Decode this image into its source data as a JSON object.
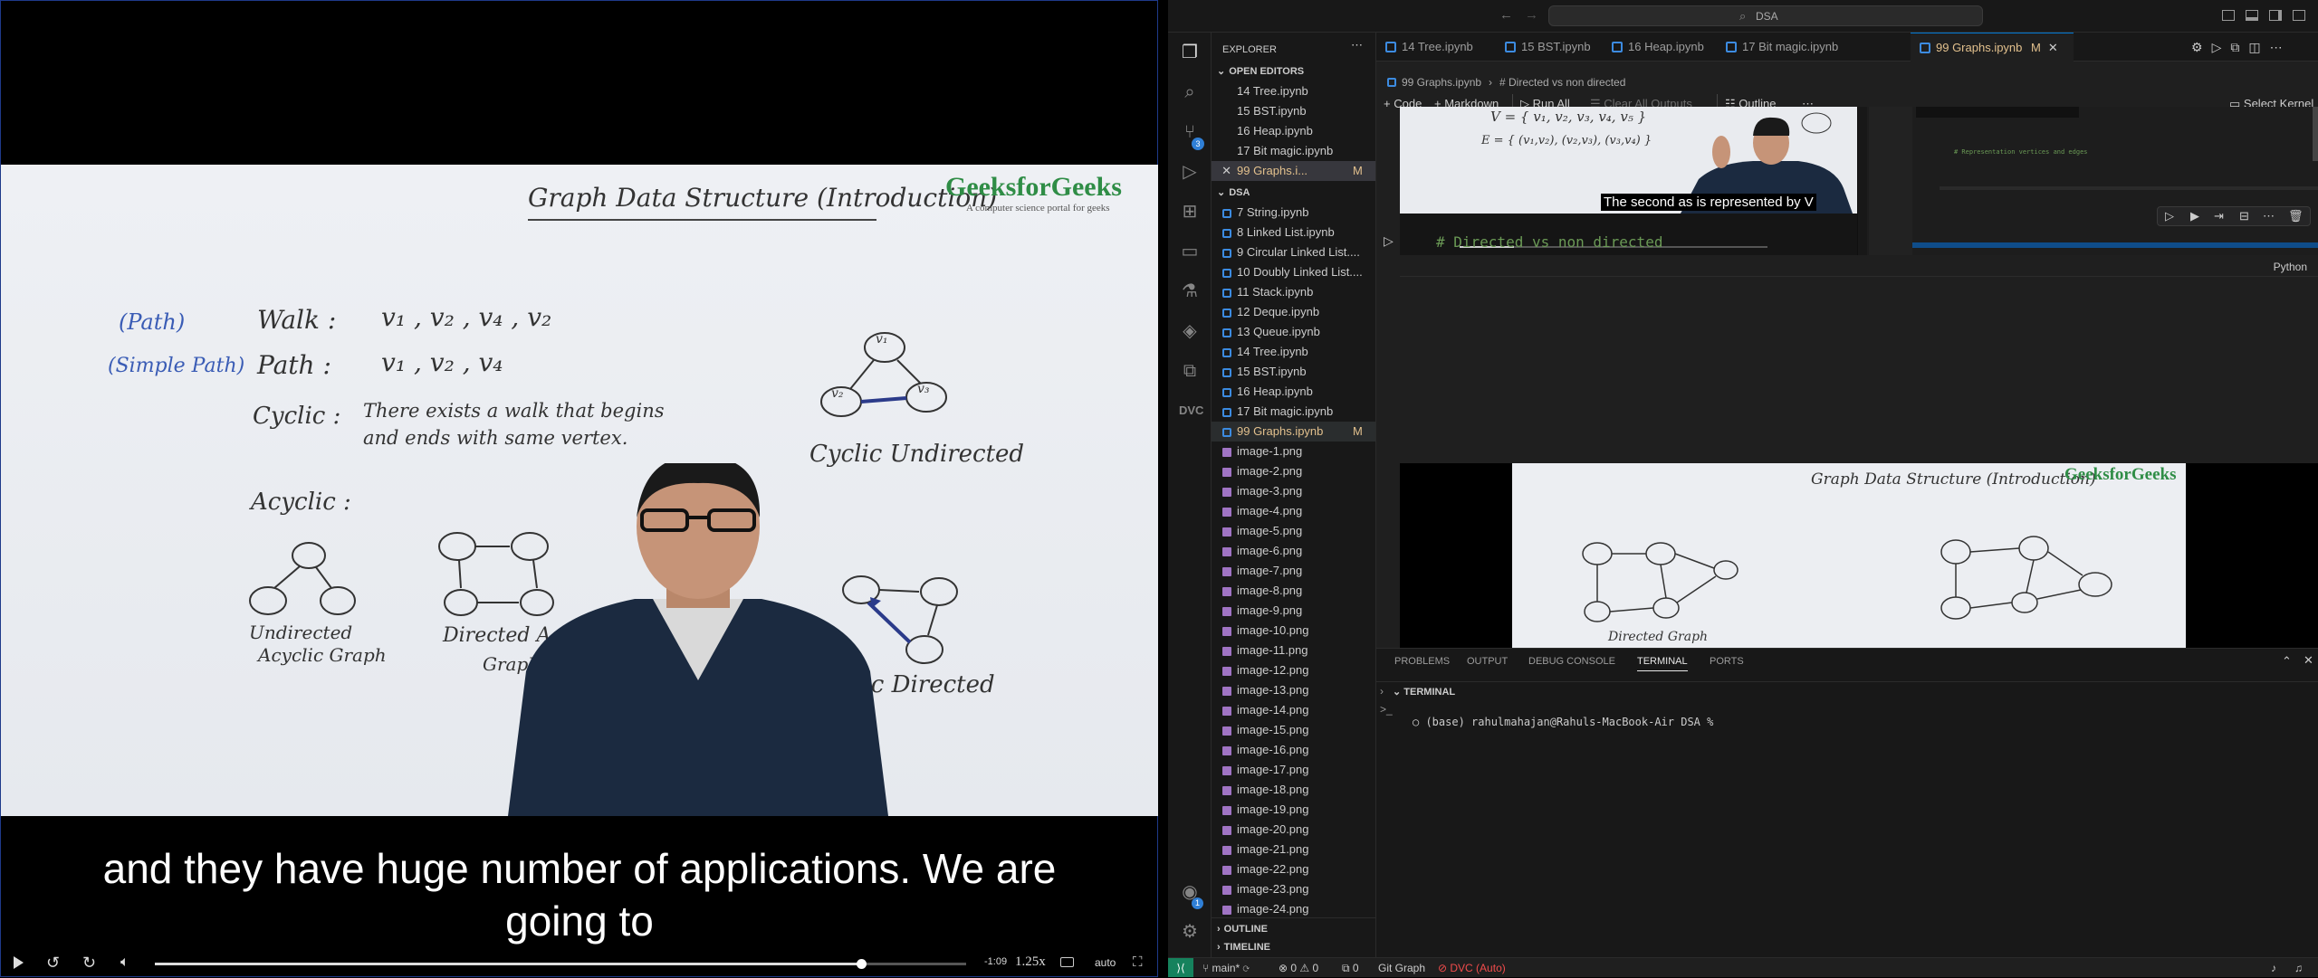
{
  "video": {
    "board_title": "Graph Data Structure (Introduction)",
    "brand": "GeeksforGeeks",
    "brand_tagline": "A computer science portal for geeks",
    "walk_tag": "(Path)",
    "walk_label": "Walk :",
    "walk_value": "v₁ , v₂ , v₄ , v₂",
    "path_tag": "(Simple Path)",
    "path_label": "Path :",
    "path_value": "v₁ , v₂ , v₄",
    "cyclic_label": "Cyclic :",
    "cyclic_def_1": "There exists a walk that begins",
    "cyclic_def_2": "and ends with same vertex.",
    "acyclic_label": "Acyclic :",
    "undirected_acyclic_1": "Undirected",
    "undirected_acyclic_2": "Acyclic Graph",
    "dag_1": "Directed Acyclic",
    "dag_2": "Graph (DAG)",
    "cyclic_undirected": "Cyclic Undirected",
    "cyclic_directed": "Cyclic Directed",
    "node_v1": "v₁",
    "node_v2": "v₂",
    "node_v3": "v₃",
    "subtitle_line1": "and they have huge number of applications. We are",
    "subtitle_line2": "going to",
    "time_remaining": "-1:09",
    "speed": "1.25x",
    "quality": "auto",
    "progress": 0.87
  },
  "vscode": {
    "search_text": "DSA",
    "explorer_title": "EXPLORER",
    "open_editors_title": "OPEN EDITORS",
    "open_editors": [
      "14 Tree.ipynb",
      "15 BST.ipynb",
      "16 Heap.ipynb",
      "17 Bit magic.ipynb",
      "99 Graphs.i..."
    ],
    "modified_flag": "M",
    "folder_title": "DSA",
    "files": [
      "7 String.ipynb",
      "8 Linked List.ipynb",
      "9 Circular Linked List....",
      "10 Doubly Linked List....",
      "11 Stack.ipynb",
      "12 Deque.ipynb",
      "13 Queue.ipynb",
      "14 Tree.ipynb",
      "15 BST.ipynb",
      "16 Heap.ipynb",
      "17 Bit magic.ipynb",
      "99 Graphs.ipynb",
      "image-1.png",
      "image-2.png",
      "image-3.png",
      "image-4.png",
      "image-5.png",
      "image-6.png",
      "image-7.png",
      "image-8.png",
      "image-9.png",
      "image-10.png",
      "image-11.png",
      "image-12.png",
      "image-13.png",
      "image-14.png",
      "image-15.png",
      "image-16.png",
      "image-17.png",
      "image-18.png",
      "image-19.png",
      "image-20.png",
      "image-21.png",
      "image-22.png",
      "image-23.png",
      "image-24.png"
    ],
    "outline_label": "OUTLINE",
    "timeline_label": "TIMELINE",
    "tabs": [
      "14 Tree.ipynb",
      "15 BST.ipynb",
      "16 Heap.ipynb",
      "17 Bit magic.ipynb",
      "99 Graphs.ipynb"
    ],
    "breadcrumb_file": "99 Graphs.ipynb",
    "breadcrumb_section": "# Directed vs non directed",
    "toolbar": {
      "code": "Code",
      "markdown": "Markdown",
      "run_all": "Run All",
      "clear_outputs": "Clear All Outputs",
      "outline": "Outline",
      "select_kernel": "Select Kernel"
    },
    "inner_caption": "The second as is represented by V",
    "inner_set_v": "V = { v₁, v₂, v₃, v₄, v₅ }",
    "inner_set_e": "E = { (v₁,v₂), (v₂,v₃), (v₃,v₄) }",
    "inner_code_comment": "# Representation vertices and edges",
    "cell_code": "# Directed vs non directed",
    "cell_lang": "Python",
    "image_title": "Graph Data Structure (Introduction)",
    "image_brand": "GeeksforGeeks",
    "image_caption": "Directed Graph",
    "panel_tabs": [
      "PROBLEMS",
      "OUTPUT",
      "DEBUG CONSOLE",
      "TERMINAL",
      "PORTS"
    ],
    "terminal_header": "TERMINAL",
    "terminal_prompt": "(base) rahulmahajan@Rahuls-MacBook-Air DSA %",
    "status": {
      "branch": "main*",
      "errors": "0",
      "warnings": "0",
      "ports": "0",
      "git_graph": "Git Graph",
      "dvc": "DVC (Auto)"
    },
    "scm_badge": "3",
    "account_badge": "1"
  }
}
